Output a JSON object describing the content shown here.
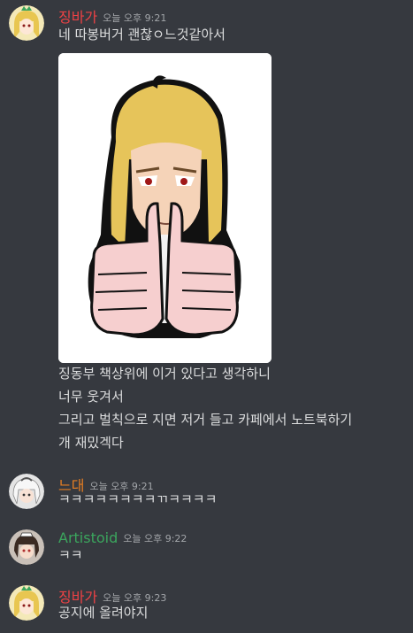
{
  "colors": {
    "background": "#36393f",
    "text": "#dcddde",
    "timestamp": "#a3a6aa",
    "user_jingbaga": "#ed4245",
    "user_neudae": "#e67e22",
    "user_artistoid": "#3ba55d"
  },
  "messages": [
    {
      "author": "징바가",
      "time": "오늘 오후 9:21",
      "lines": [
        "네 따봉버거 괜찮ㅇ느것같아서"
      ],
      "attachment": "thumbs-up-character-image",
      "lines_after": [
        "징동부 책상위에 이거 있다고 생각하니",
        "너무 웃겨서",
        "그리고 벌칙으로 지면 저거 들고 카페에서 노트북하기",
        "개 재밌겍다"
      ]
    },
    {
      "author": "느대",
      "time": "오늘 오후 9:21",
      "lines": [
        "ㅋㅋㅋㅋㅋㅋㅋㅋㄲㅋㅋㅋㅋ"
      ]
    },
    {
      "author": "Artistoid",
      "time": "오늘 오후 9:22",
      "lines": [
        "ㅋㅋ"
      ]
    },
    {
      "author": "징바가",
      "time": "오늘 오후 9:23",
      "lines": [
        "공지에 올려야지"
      ]
    }
  ]
}
